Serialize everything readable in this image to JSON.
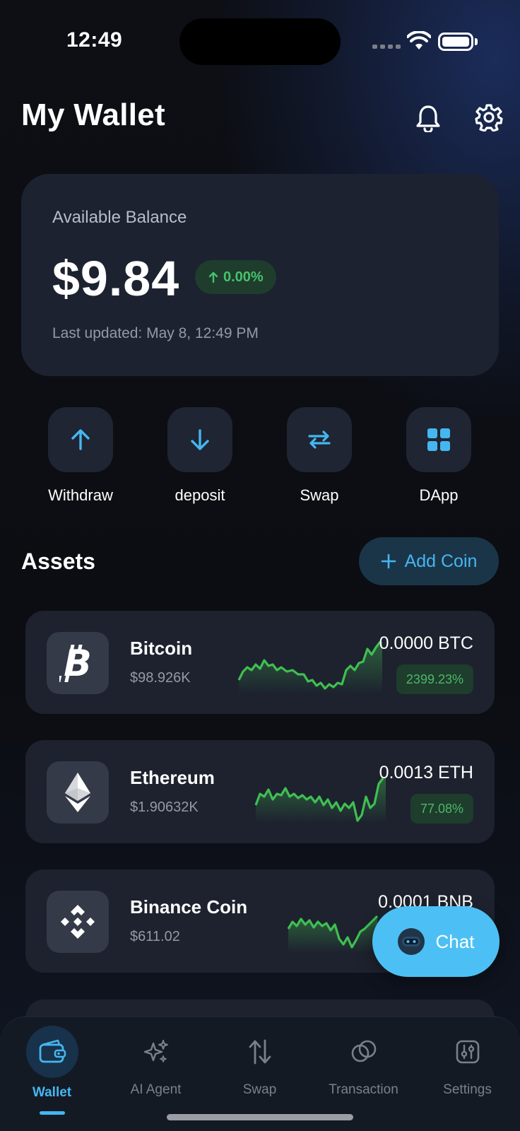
{
  "status_bar": {
    "time": "12:49"
  },
  "header": {
    "title": "My Wallet",
    "bell_icon": "bell-icon",
    "settings_icon": "gear-icon"
  },
  "balance": {
    "label": "Available Balance",
    "amount": "$9.84",
    "change": "0.00%",
    "last_updated": "Last updated: May 8, 12:49 PM"
  },
  "actions": [
    {
      "label": "Withdraw",
      "icon": "arrow-up-icon"
    },
    {
      "label": "deposit",
      "icon": "arrow-down-icon"
    },
    {
      "label": "Swap",
      "icon": "swap-icon"
    },
    {
      "label": "DApp",
      "icon": "grid-icon"
    }
  ],
  "assets": {
    "title": "Assets",
    "add_label": "Add Coin",
    "items": [
      {
        "name": "Bitcoin",
        "price": "$98.926K",
        "amount": "0.0000 BTC",
        "change": "2399.23%",
        "icon": "bitcoin-icon"
      },
      {
        "name": "Ethereum",
        "price": "$1.90632K",
        "amount": "0.0013 ETH",
        "change": "77.08%",
        "icon": "ethereum-icon"
      },
      {
        "name": "Binance Coin",
        "price": "$611.02",
        "amount": "0.0001 BNB",
        "change": "",
        "icon": "binance-icon"
      }
    ]
  },
  "chat": {
    "label": "Chat",
    "icon": "robot-icon"
  },
  "nav": [
    {
      "label": "Wallet",
      "icon": "wallet-icon",
      "active": true
    },
    {
      "label": "AI Agent",
      "icon": "sparkle-icon",
      "active": false
    },
    {
      "label": "Swap",
      "icon": "swap-vertical-icon",
      "active": false
    },
    {
      "label": "Transaction",
      "icon": "coins-icon",
      "active": false
    },
    {
      "label": "Settings",
      "icon": "sliders-icon",
      "active": false
    }
  ],
  "colors": {
    "accent": "#45b6f0",
    "positive": "#49c06a",
    "card": "#1d222e"
  }
}
